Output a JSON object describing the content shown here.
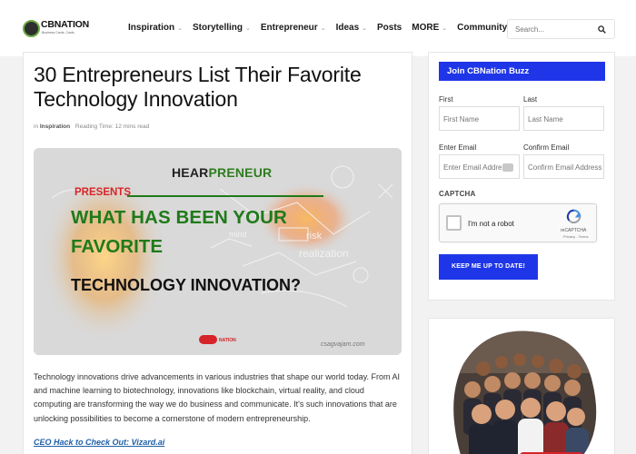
{
  "brand": {
    "name": "CBNATION",
    "tagline": "Business Cards, Cards"
  },
  "nav": {
    "items": [
      {
        "label": "Inspiration",
        "has_dropdown": true
      },
      {
        "label": "Storytelling",
        "has_dropdown": true
      },
      {
        "label": "Entrepreneur",
        "has_dropdown": true
      },
      {
        "label": "Ideas",
        "has_dropdown": true
      },
      {
        "label": "Posts",
        "has_dropdown": false
      },
      {
        "label": "MORE",
        "has_dropdown": true
      },
      {
        "label": "Community",
        "has_dropdown": true
      }
    ],
    "search_placeholder": "Search..."
  },
  "article": {
    "title": "30 Entrepreneurs List Their Favorite Technology Innovation",
    "meta_prefix": "in",
    "category": "Inspiration",
    "reading_time": "Reading Time: 12 mins read",
    "hero": {
      "brand_a": "HEAR",
      "brand_b": "PRENEUR",
      "presents": "PRESENTS",
      "question_line1": "WHAT HAS BEEN YOUR",
      "question_line2": "FAVORITE",
      "question_line3": "TECHNOLOGY INNOVATION?",
      "footer_logo": "NATION",
      "url": "csagvajam.com"
    },
    "paragraph": "Technology innovations drive advancements in various industries that shape our world today. From AI and machine learning to biotechnology, innovations like blockchain, virtual reality, and cloud computing are transforming the way we do business and communicate. It's such innovations that are unlocking possibilities to become a cornerstone of modern entrepreneurship.",
    "ceo_link": "CEO Hack to Check Out: Vizard.ai"
  },
  "signup": {
    "header": "Join CBNation Buzz",
    "first_label": "First",
    "first_placeholder": "First Name",
    "last_label": "Last",
    "last_placeholder": "Last Name",
    "email_label": "Enter Email",
    "email_placeholder": "Enter Email Address",
    "confirm_label": "Confirm Email",
    "confirm_placeholder": "Confirm Email Address",
    "captcha_label": "CAPTCHA",
    "recaptcha_text": "I'm not a robot",
    "recaptcha_brand": "reCAPTCHA",
    "recaptcha_terms": "Privacy - Terms",
    "submit_label": "KEEP ME UP TO DATE!"
  },
  "colors": {
    "accent": "#1f36e8",
    "link": "#1f5fa8",
    "hero_green": "#1f7a1a",
    "hero_red": "#d6242a"
  }
}
